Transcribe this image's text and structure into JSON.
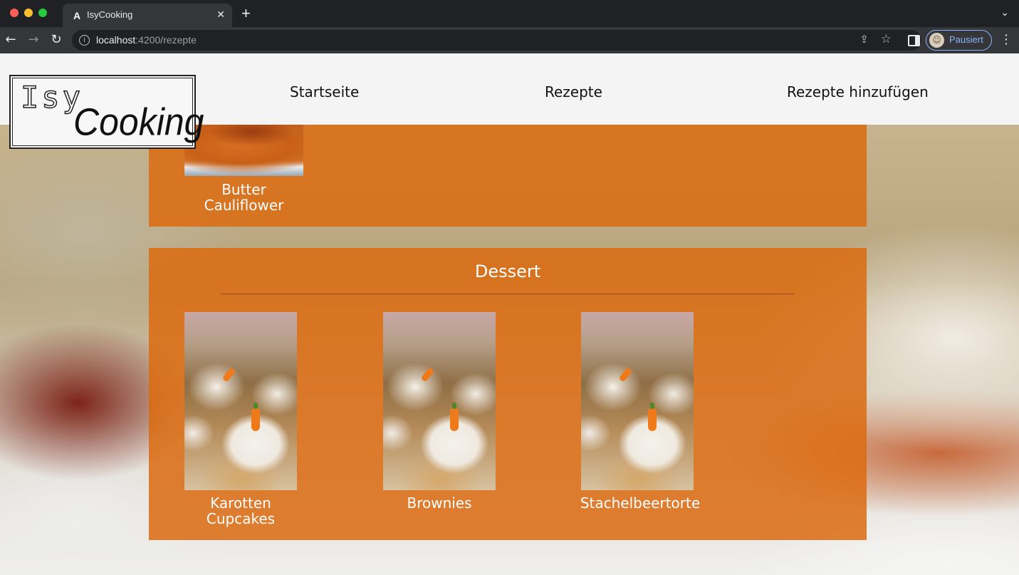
{
  "browser": {
    "tab_title": "IsyCooking",
    "tab_close": "✕",
    "new_tab": "+",
    "url_host": "localhost",
    "url_rest": ":4200/rezepte",
    "profile_label": "Pausiert"
  },
  "site": {
    "logo_top": "Isy",
    "logo_bottom": "Cooking",
    "nav": {
      "home": "Startseite",
      "recipes": "Rezepte",
      "add": "Rezepte hinzufügen"
    }
  },
  "sections": {
    "main_partial": {
      "recipes": [
        {
          "title_line1": "Butter",
          "title_line2": "Cauliflower"
        }
      ]
    },
    "dessert": {
      "heading": "Dessert",
      "recipes": [
        {
          "title_line1": "Karotten",
          "title_line2": "Cupcakes"
        },
        {
          "title": "Brownies"
        },
        {
          "title": "Stachelbeertorte"
        }
      ]
    }
  },
  "icons": {
    "back": "back-arrow-icon",
    "forward": "forward-arrow-icon",
    "reload": "reload-icon",
    "info": "info-icon",
    "share": "share-icon",
    "star": "star-icon",
    "side_panel": "side-panel-icon",
    "menu": "kebab-menu-icon"
  },
  "colors": {
    "panel": "#db6b12",
    "header_bg": "#f4f4f4",
    "chrome_dark": "#202124",
    "chrome_toolbar": "#35363a",
    "profile_accent": "#8ab4f8"
  }
}
